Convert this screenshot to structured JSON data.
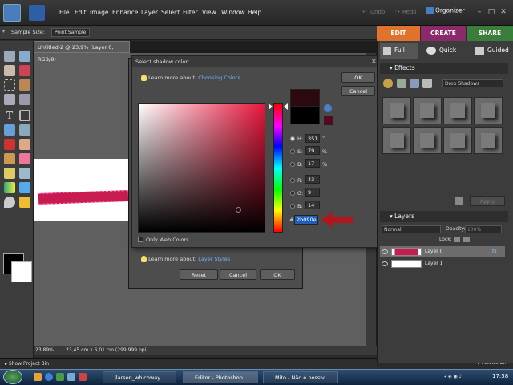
{
  "menu": {
    "items": [
      "File",
      "Edit",
      "Image",
      "Enhance",
      "Layer",
      "Select",
      "Filter",
      "View",
      "Window",
      "Help"
    ],
    "undo": "Undo",
    "redo": "Redo",
    "organizer": "Organizer"
  },
  "options_bar": {
    "sample_size_label": "Sample Size:",
    "sample_size_value": "Point Sample"
  },
  "mode_tabs": [
    "EDIT",
    "CREATE",
    "SHARE"
  ],
  "mode_colors": {
    "edit": "#e0732b",
    "create": "#8a2a6a",
    "share": "#3b7d3b"
  },
  "sub_tabs": [
    "Full",
    "Quick",
    "Guided"
  ],
  "document": {
    "tab_title": "Untitled-2 @ 23,9% (Layer 0, RGB/8)",
    "zoom": "23,89%",
    "dimensions": "23,45 cm x 6,01 cm (299,999 ppi)"
  },
  "project_bin": {
    "label": "Show Project Bin",
    "palette_bin": "Palette Bin"
  },
  "color_picker": {
    "title": "Select shadow color:",
    "learn_text": "Learn more about:",
    "learn_link": "Choosing Colors",
    "ok": "OK",
    "cancel": "Cancel",
    "fields": {
      "H": {
        "value": "351",
        "unit": "°"
      },
      "S": {
        "value": "79",
        "unit": "%"
      },
      "B": {
        "value": "17",
        "unit": "%"
      },
      "R": {
        "value": "43",
        "unit": ""
      },
      "G": {
        "value": "9",
        "unit": ""
      },
      "Bl": {
        "value": "14",
        "unit": ""
      }
    },
    "hex_label": "#",
    "hex_value": "2b090e",
    "new_color": "#2b090e",
    "old_color": "#000000",
    "only_web_colors": "Only Web Colors"
  },
  "layer_style": {
    "learn_text": "Learn more about:",
    "learn_link": "Layer Styles",
    "reset": "Reset",
    "cancel": "Cancel",
    "ok": "OK"
  },
  "effects_panel": {
    "title": "Effects",
    "category": "Drop Shadows",
    "apply": "Apply"
  },
  "layers_panel": {
    "title": "Layers",
    "blend_mode": "Normal",
    "opacity_label": "Opacity:",
    "opacity_value": "100%",
    "lock_label": "Lock:",
    "layers": [
      "Layer 0",
      "Layer 1"
    ]
  },
  "taskbar": {
    "tasks": [
      "jlarsen_whichway",
      "Editor - Photoshop ...",
      "Mito - Não é possív..."
    ],
    "clock": "17:58"
  }
}
